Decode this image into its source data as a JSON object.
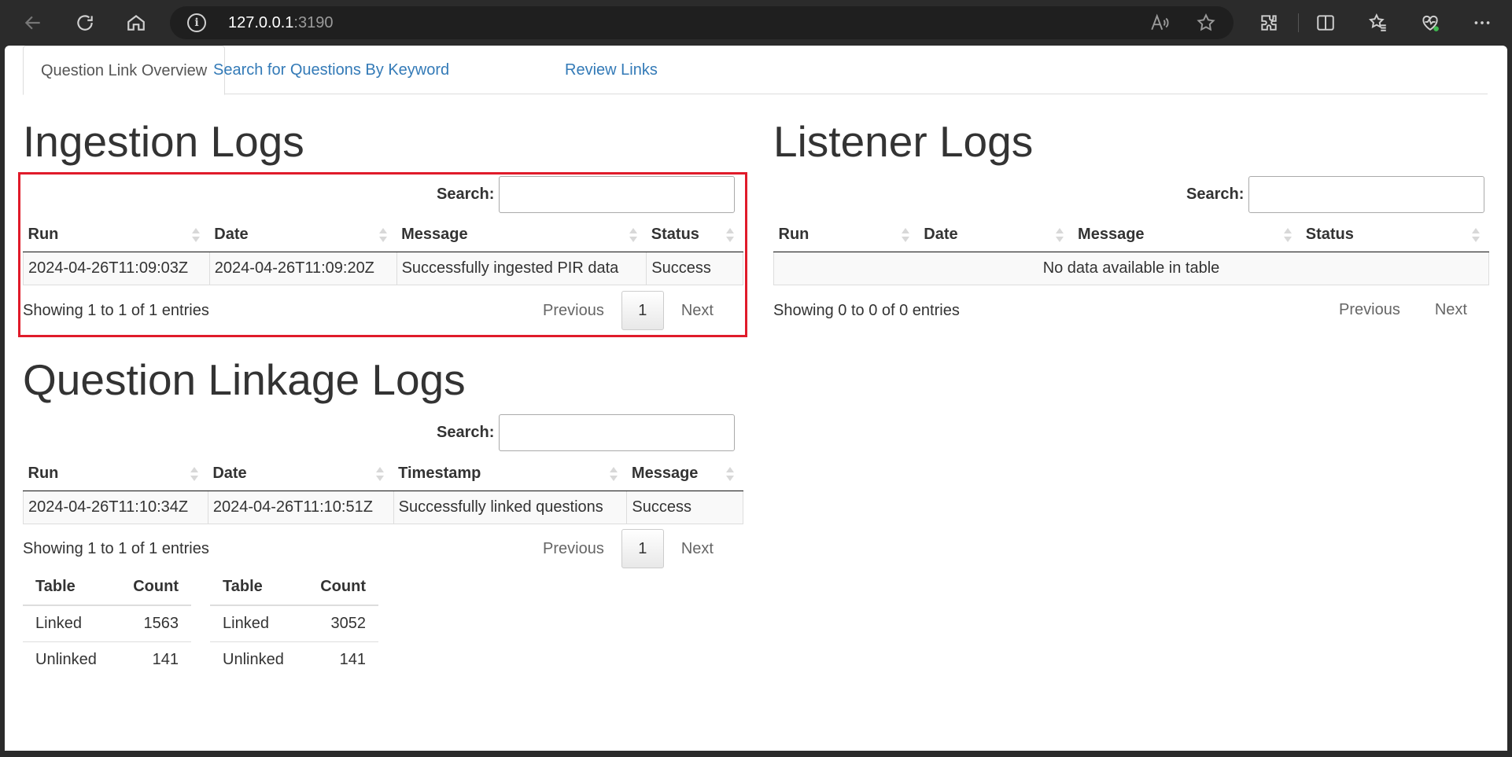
{
  "browser": {
    "url_host": "127.0.0.1",
    "url_port": ":3190"
  },
  "tabs": [
    {
      "label": "Question Link Overview"
    },
    {
      "label": "Search for Questions By Keyword"
    },
    {
      "label": "Review Links"
    }
  ],
  "ingestion": {
    "title": "Ingestion Logs",
    "search_label": "Search:",
    "columns": [
      "Run",
      "Date",
      "Message",
      "Status"
    ],
    "rows": [
      [
        "2024-04-26T11:09:03Z",
        "2024-04-26T11:09:20Z",
        "Successfully ingested PIR data",
        "Success"
      ]
    ],
    "info": "Showing 1 to 1 of 1 entries",
    "previous": "Previous",
    "page": "1",
    "next": "Next"
  },
  "listener": {
    "title": "Listener Logs",
    "search_label": "Search:",
    "columns": [
      "Run",
      "Date",
      "Message",
      "Status"
    ],
    "empty": "No data available in table",
    "info": "Showing 0 to 0 of 0 entries",
    "previous": "Previous",
    "next": "Next"
  },
  "linkage": {
    "title": "Question Linkage Logs",
    "search_label": "Search:",
    "columns": [
      "Run",
      "Date",
      "Timestamp",
      "Message"
    ],
    "rows": [
      [
        "2024-04-26T11:10:34Z",
        "2024-04-26T11:10:51Z",
        "Successfully linked questions",
        "Success"
      ]
    ],
    "info": "Showing 1 to 1 of 1 entries",
    "previous": "Previous",
    "page": "1",
    "next": "Next"
  },
  "counts": [
    {
      "headers": [
        "Table",
        "Count"
      ],
      "rows": [
        [
          "Linked",
          "1563"
        ],
        [
          "Unlinked",
          "141"
        ]
      ]
    },
    {
      "headers": [
        "Table",
        "Count"
      ],
      "rows": [
        [
          "Linked",
          "3052"
        ],
        [
          "Unlinked",
          "141"
        ]
      ]
    }
  ],
  "colors": {
    "link": "#337ab7",
    "highlight": "#e01b2a"
  }
}
